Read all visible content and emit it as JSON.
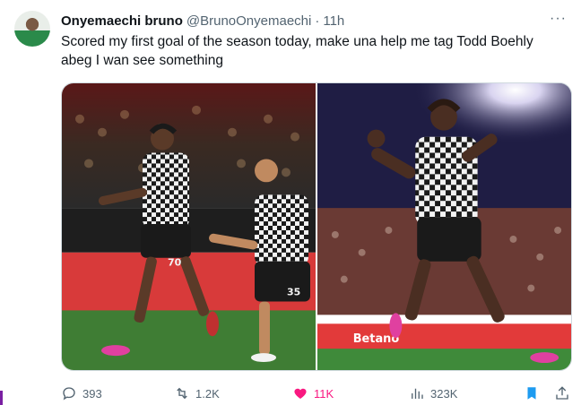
{
  "tweet": {
    "name": "Onyemaechi bruno",
    "handle": "@BrunoOnyemaechi",
    "separator": "·",
    "time": "11h",
    "more_label": "···",
    "text": "Scored my first goal of the season today, make una help me tag Todd Boehly abeg I wan see something"
  },
  "media": {
    "photos": [
      {
        "jersey_number_front": "70",
        "jersey_number_back": "35"
      },
      {
        "ad_text": "Betano"
      }
    ]
  },
  "actions": {
    "replies": "393",
    "retweets": "1.2K",
    "likes": "11K",
    "views": "323K"
  },
  "colors": {
    "like_active": "#f91880",
    "bookmark_active": "#1d9bf0",
    "secondary_text": "#536471"
  },
  "icons": [
    "reply-icon",
    "retweet-icon",
    "heart-icon",
    "views-icon",
    "bookmark-icon",
    "share-icon",
    "more-icon"
  ]
}
